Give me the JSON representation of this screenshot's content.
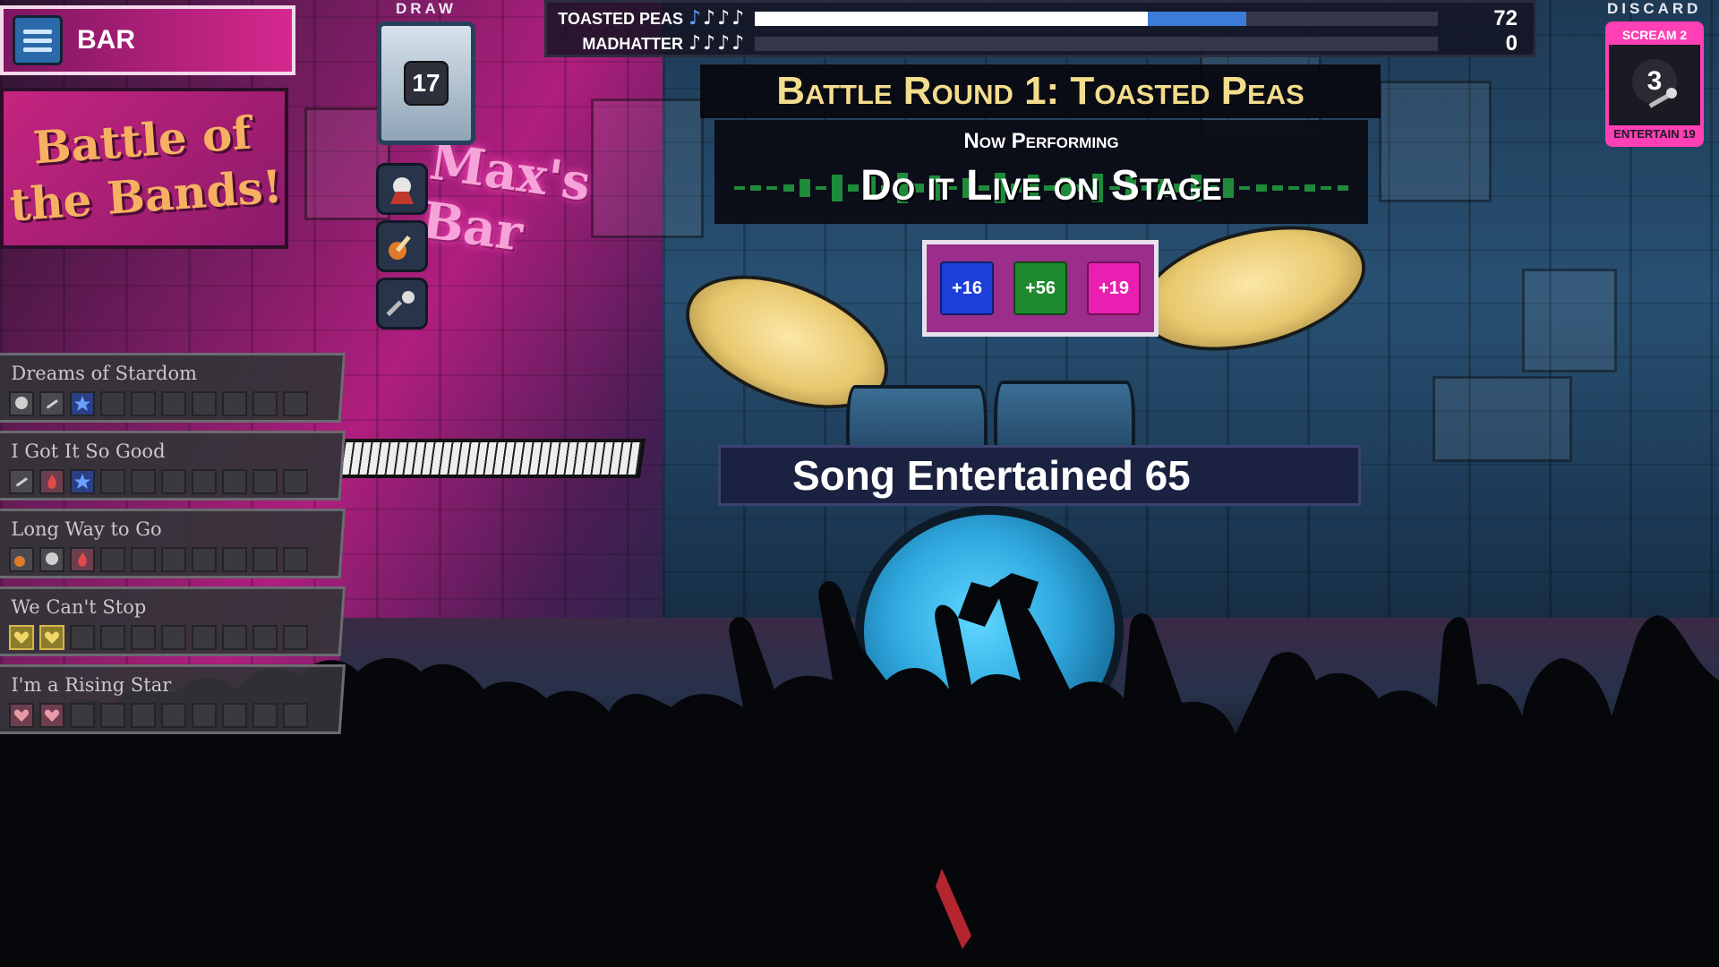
{
  "menu": {
    "label": "BAR"
  },
  "event_title": "Battle of the Bands!",
  "venue_sign": "Max's Bar",
  "draw_pile": {
    "label": "DRAW",
    "count": "17"
  },
  "discard_pile": {
    "label": "DISCARD",
    "top_label": "SCREAM 2",
    "count": "3",
    "bottom_label": "ENTERTAIN 19"
  },
  "scoreboard": {
    "teams": [
      {
        "name": "TOASTED PEAS",
        "notes": [
          "♪",
          "♪",
          "♪",
          "♪"
        ],
        "score": "72",
        "progress": 0.72
      },
      {
        "name": "MADHATTER",
        "notes": [
          "♪",
          "♪",
          "♪",
          "♪"
        ],
        "score": "0",
        "progress": 0
      }
    ]
  },
  "round_banner": "Battle Round 1: Toasted Peas",
  "now_performing": {
    "label": "Now Performing",
    "song": "Do it Live on Stage"
  },
  "bonuses": [
    {
      "value": "+16",
      "color": "#1c3fd9"
    },
    {
      "value": "+56",
      "color": "#1e8a2e"
    },
    {
      "value": "+19",
      "color": "#e81fb0"
    }
  ],
  "result_text": "Song Entertained 65",
  "songs": [
    {
      "title": "Dreams of Stardom",
      "slots": [
        "skull-icon",
        "mic-icon",
        "star-icon",
        "",
        "",
        "",
        "",
        "",
        "",
        ""
      ]
    },
    {
      "title": "I Got It So Good",
      "slots": [
        "mic-icon",
        "flame-icon",
        "star-icon",
        "",
        "",
        "",
        "",
        "",
        "",
        ""
      ]
    },
    {
      "title": "Long Way to Go",
      "slots": [
        "guitar-icon",
        "skull-icon",
        "flame-icon",
        "",
        "",
        "",
        "",
        "",
        "",
        ""
      ]
    },
    {
      "title": "We Can't Stop",
      "slots": [
        "heart-gold-icon",
        "heart-gold-icon",
        "",
        "",
        "",
        "",
        "",
        "",
        "",
        ""
      ]
    },
    {
      "title": "I'm a Rising Star",
      "slots": [
        "heart-icon",
        "heart-icon",
        "",
        "",
        "",
        "",
        "",
        "",
        "",
        ""
      ]
    }
  ],
  "tools": [
    "hero-icon",
    "guitar-icon",
    "mic-icon"
  ]
}
